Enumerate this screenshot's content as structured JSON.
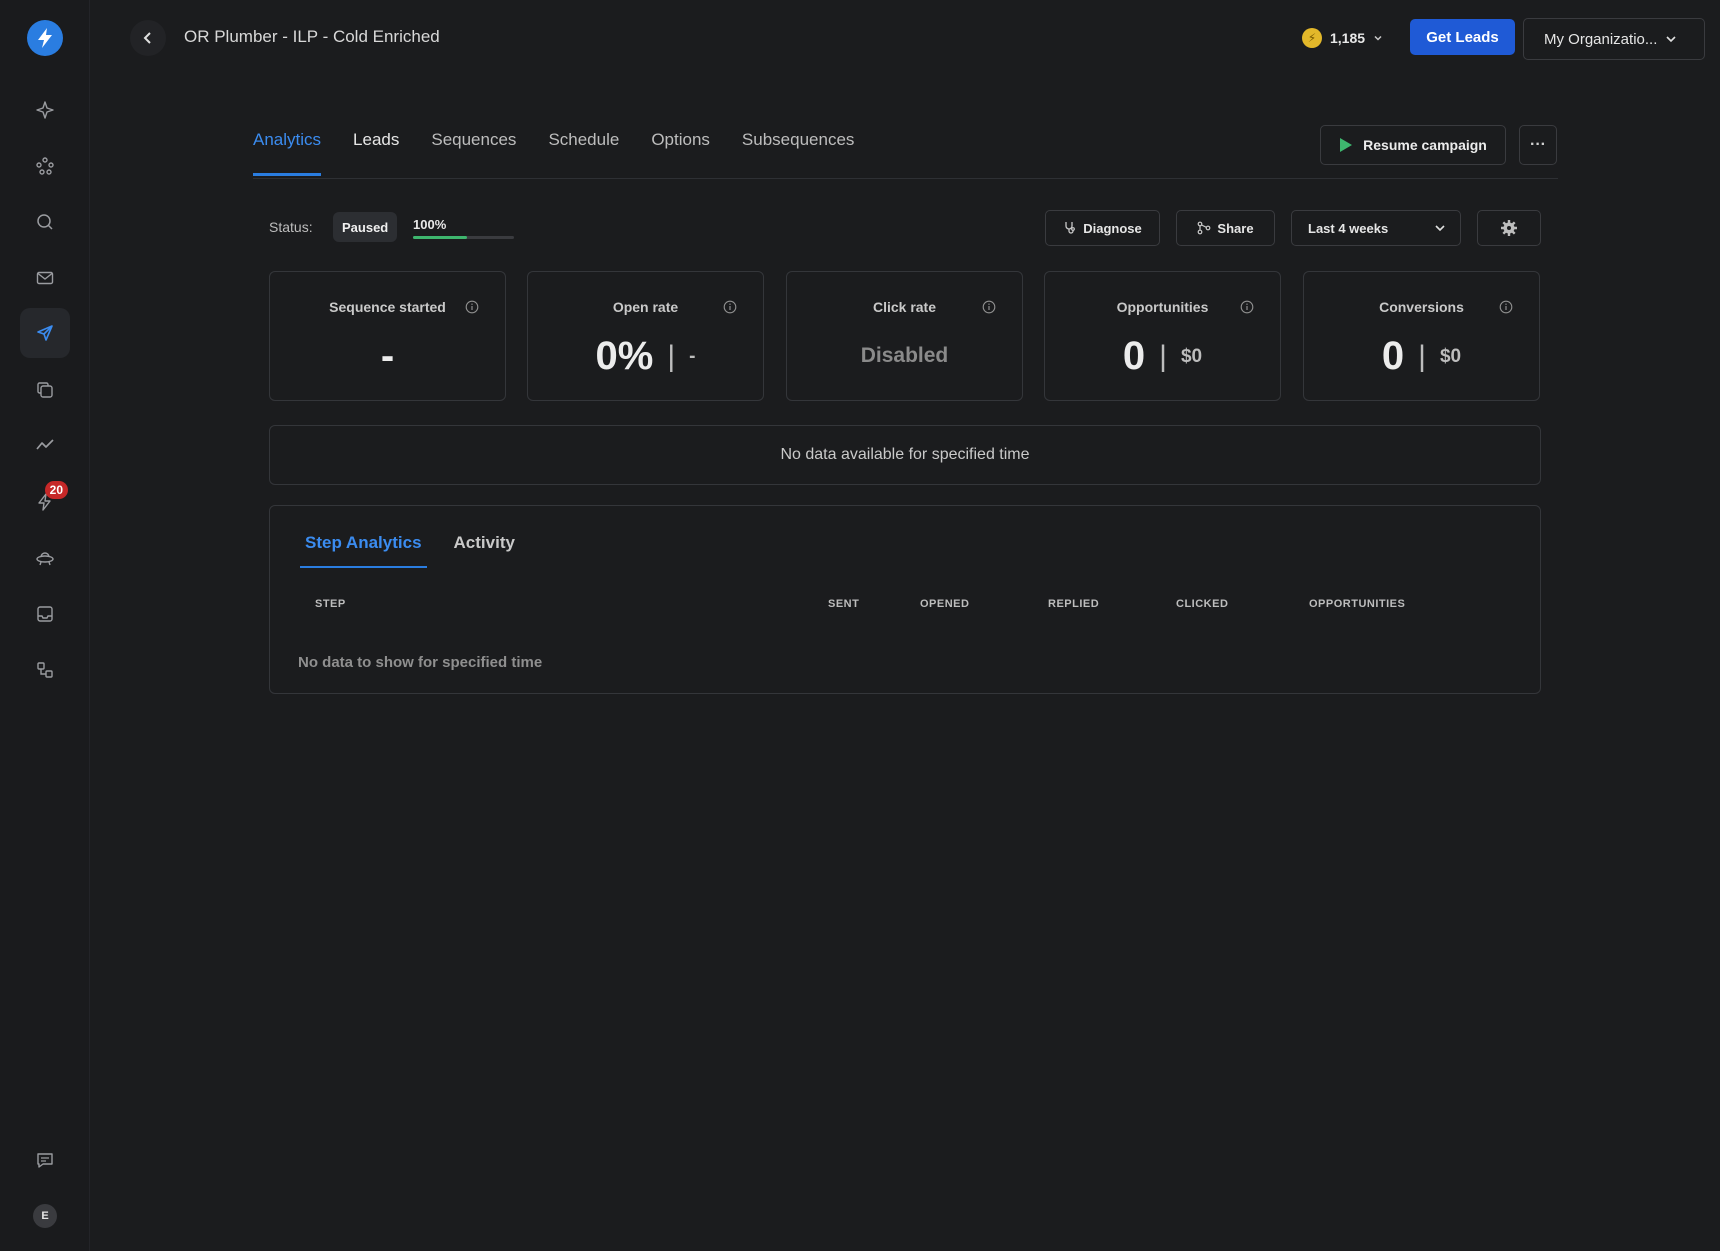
{
  "header": {
    "title": "OR Plumber - ILP - Cold Enriched",
    "credits": "1,185",
    "get_leads_label": "Get Leads",
    "org_label": "My Organizatio..."
  },
  "sidebar": {
    "items": [
      {
        "icon": "sparkle-icon"
      },
      {
        "icon": "network-icon"
      },
      {
        "icon": "search-icon"
      },
      {
        "icon": "mail-icon"
      },
      {
        "icon": "send-icon",
        "active": true
      },
      {
        "icon": "copy-icon"
      },
      {
        "icon": "analytics-icon"
      },
      {
        "icon": "bolt-icon",
        "badge": "20"
      },
      {
        "icon": "ufo-icon"
      },
      {
        "icon": "inbox-icon"
      },
      {
        "icon": "integrations-icon"
      }
    ],
    "avatar_initial": "E"
  },
  "tabs": [
    {
      "label": "Analytics",
      "active": true
    },
    {
      "label": "Leads"
    },
    {
      "label": "Sequences"
    },
    {
      "label": "Schedule"
    },
    {
      "label": "Options"
    },
    {
      "label": "Subsequences"
    }
  ],
  "resume_label": "Resume campaign",
  "status": {
    "label": "Status:",
    "value": "Paused",
    "progress_text": "100%",
    "progress_fill_fraction": 0.53
  },
  "toolbar": {
    "diagnose_label": "Diagnose",
    "share_label": "Share",
    "range_label": "Last 4 weeks"
  },
  "cards": {
    "sequence_started": {
      "title": "Sequence started",
      "value": "-"
    },
    "open_rate": {
      "title": "Open rate",
      "value": "0%",
      "secondary": "-"
    },
    "click_rate": {
      "title": "Click rate",
      "value": "Disabled"
    },
    "opportunities": {
      "title": "Opportunities",
      "value": "0",
      "secondary": "$0"
    },
    "conversions": {
      "title": "Conversions",
      "value": "0",
      "secondary": "$0"
    }
  },
  "no_data_message": "No data available for specified time",
  "step_panel": {
    "tabs": [
      {
        "label": "Step Analytics",
        "active": true
      },
      {
        "label": "Activity"
      }
    ],
    "columns": [
      "STEP",
      "SENT",
      "OPENED",
      "REPLIED",
      "CLICKED",
      "OPPORTUNITIES"
    ],
    "empty_message": "No data to show for specified time"
  },
  "colors": {
    "accent": "#2a7de1",
    "primary_button": "#1f5ad6",
    "progress": "#3eb66e",
    "badge": "#c62828"
  }
}
